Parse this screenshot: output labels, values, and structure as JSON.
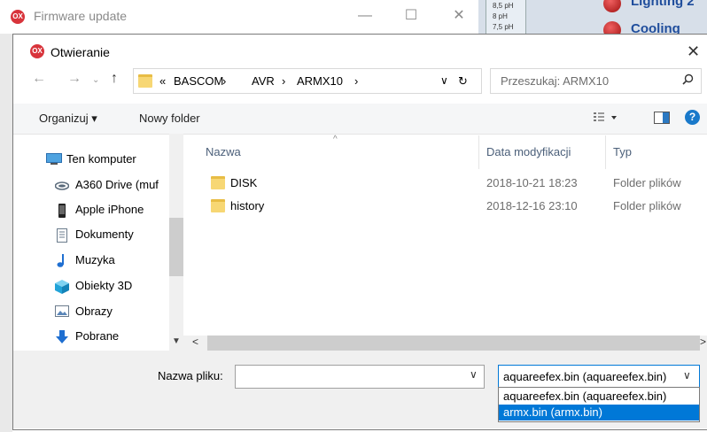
{
  "background_window": {
    "title": "Firmware update",
    "logo_text": "OX",
    "minimize": "—",
    "maximize": "☐",
    "close": "✕",
    "ph_labels": [
      "8,5 pH",
      "8 pH",
      "7,5 pH"
    ],
    "status_items": [
      "Lighting 2",
      "Cooling"
    ]
  },
  "dialog": {
    "logo_text": "OX",
    "title": "Otwieranie",
    "close": "✕",
    "address": {
      "prefix": "«",
      "crumbs": [
        "BASCOM",
        "AVR",
        "ARMX10"
      ],
      "separator": "›"
    },
    "search_placeholder": "Przeszukaj: ARMX10",
    "toolbar": {
      "organize": "Organizuj ▾",
      "new_folder": "Nowy folder"
    },
    "nav_pane": [
      {
        "label": "Ten komputer",
        "icon": "computer-icon"
      },
      {
        "label": "A360 Drive (muf",
        "icon": "cloud-drive-icon"
      },
      {
        "label": "Apple iPhone",
        "icon": "phone-icon"
      },
      {
        "label": "Dokumenty",
        "icon": "documents-icon"
      },
      {
        "label": "Muzyka",
        "icon": "music-icon"
      },
      {
        "label": "Obiekty 3D",
        "icon": "objects-3d-icon"
      },
      {
        "label": "Obrazy",
        "icon": "pictures-icon"
      },
      {
        "label": "Pobrane",
        "icon": "downloads-icon"
      }
    ],
    "columns": {
      "name": "Nazwa",
      "date": "Data modyfikacji",
      "type": "Typ"
    },
    "files": [
      {
        "name": "DISK",
        "date": "2018-10-21 18:23",
        "type": "Folder plików"
      },
      {
        "name": "history",
        "date": "2018-12-16 23:10",
        "type": "Folder plików"
      }
    ],
    "filename_label": "Nazwa pliku:",
    "filename_value": "",
    "filter_selected": "aquareefex.bin (aquareefex.bin)",
    "filter_options": [
      "aquareefex.bin (aquareefex.bin)",
      "armx.bin (armx.bin)"
    ],
    "filter_highlighted_index": 1
  },
  "colors": {
    "accent": "#0078d7",
    "folder": "#f7d774",
    "logo": "#d8343b",
    "help": "#1979ca"
  }
}
